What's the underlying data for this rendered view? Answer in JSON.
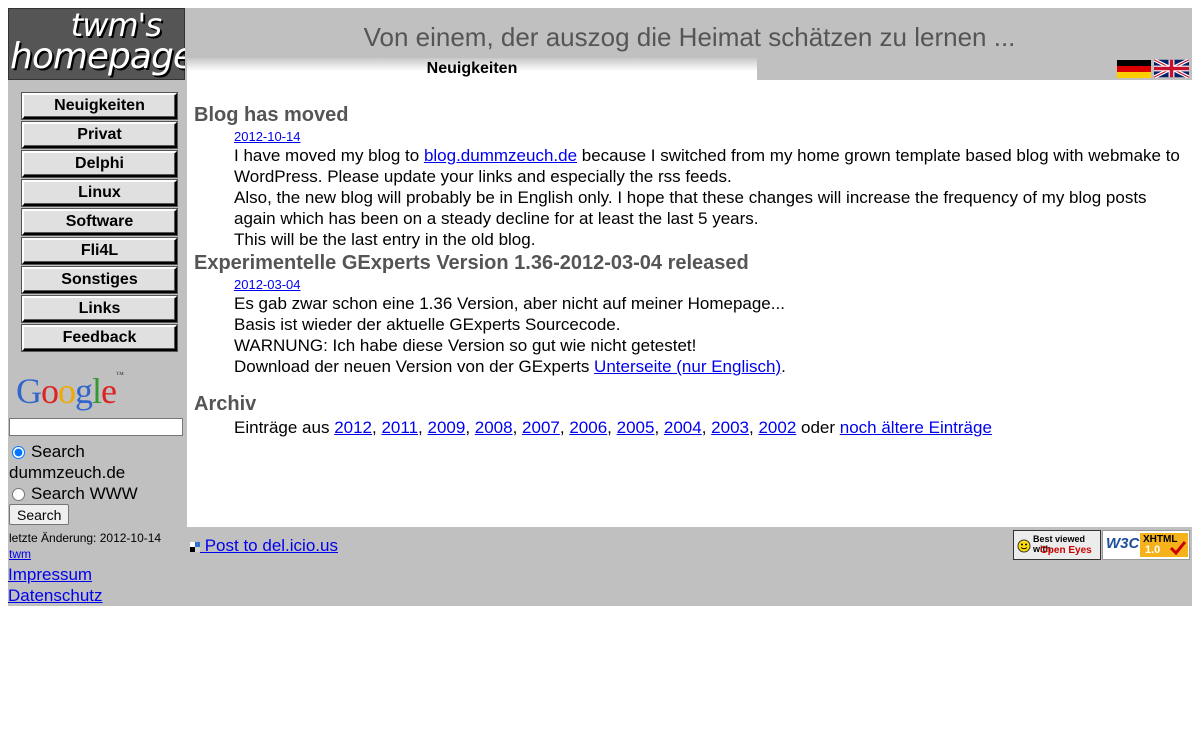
{
  "logo": {
    "line1": "twm's",
    "line2": "homepage"
  },
  "header": {
    "tagline": "Von einem, der auszog die Heimat schätzen zu lernen ...",
    "active_tab": "Neuigkeiten"
  },
  "nav": {
    "items": [
      "Neuigkeiten",
      "Privat",
      "Delphi",
      "Linux",
      "Software",
      "Fli4L",
      "Sonstiges",
      "Links",
      "Feedback"
    ]
  },
  "search": {
    "logo_text": "Google",
    "option1_line1": "Search",
    "option1_line2": "dummzeuch.de",
    "option2": "Search WWW",
    "button": "Search",
    "input_value": ""
  },
  "sidebar_footer": {
    "last_change": "letzte Änderung: 2012-10-14",
    "author": "twm",
    "impressum": "Impressum",
    "datenschutz": "Datenschutz"
  },
  "posts": [
    {
      "title": "Blog has moved",
      "date": "2012-10-14",
      "line1_pre": "I have moved my blog to ",
      "line1_link": "blog.dummzeuch.de",
      "line1_post": " because I switched from my home grown template based blog with webmake to WordPress. Please update your links and especially the rss feeds.",
      "line2": "Also, the new blog will probably be in English only. I hope that these changes will increase the frequency of my blog posts again which has been on a steady decline for at least the last 5 years.",
      "line3": "This will be the last entry in the old blog."
    },
    {
      "title": "Experimentelle GExperts Version 1.36-2012-03-04 released",
      "date": "2012-03-04",
      "line1": "Es gab zwar schon eine 1.36 Version, aber nicht auf meiner Homepage...",
      "line2": "Basis ist wieder der aktuelle GExperts Sourcecode.",
      "line3": "WARNUNG: Ich habe diese Version so gut wie nicht getestet!",
      "line4_pre": "Download der neuen Version von der GExperts ",
      "line4_link": "Unterseite (nur Englisch)",
      "line4_post": "."
    }
  ],
  "archive": {
    "title": "Archiv",
    "prefix": "Einträge aus ",
    "years": [
      "2012",
      "2011",
      "2009",
      "2008",
      "2007",
      "2006",
      "2005",
      "2004",
      "2003",
      "2002"
    ],
    "separator": ", ",
    "or": " oder ",
    "older": "noch ältere Einträge"
  },
  "footer": {
    "delicious": " Post to del.icio.us",
    "badge_eyes_line1": "Best viewed with",
    "badge_eyes_line2": "Open Eyes",
    "badge_w3c": "W3C",
    "badge_xhtml": "XHTML",
    "badge_version": "1.0"
  },
  "colors": {
    "panel_gray": "#c0c0c0",
    "heading_gray": "#555555",
    "link_blue": "#0000ee"
  }
}
